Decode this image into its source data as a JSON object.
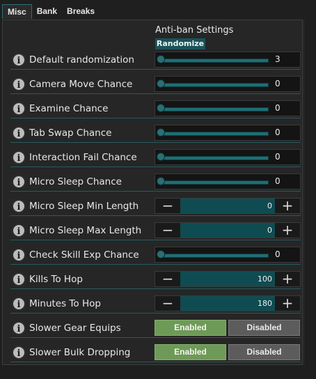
{
  "tabs": [
    {
      "label": "Misc",
      "active": true
    },
    {
      "label": "Bank"
    },
    {
      "label": "Breaks"
    }
  ],
  "section": {
    "title": "Anti-ban Settings",
    "randomize_label": "Randomize"
  },
  "rows": [
    {
      "label": "Default randomization",
      "control": "slider",
      "value": "3",
      "fraction": 0.0
    },
    {
      "label": "Camera Move Chance",
      "control": "slider",
      "value": "0",
      "fraction": 0.0
    },
    {
      "label": "Examine Chance",
      "control": "slider",
      "value": "0",
      "fraction": 0.0
    },
    {
      "label": "Tab Swap Chance",
      "control": "slider",
      "value": "0",
      "fraction": 0.0
    },
    {
      "label": "Interaction Fail Chance",
      "control": "slider",
      "value": "0",
      "fraction": 0.0
    },
    {
      "label": "Micro Sleep Chance",
      "control": "slider",
      "value": "0",
      "fraction": 0.0
    },
    {
      "label": "Micro Sleep Min Length",
      "control": "stepper",
      "value": "0",
      "minus": "−",
      "plus": "+"
    },
    {
      "label": "Micro Sleep Max Length",
      "control": "stepper",
      "value": "0",
      "minus": "−",
      "plus": "+"
    },
    {
      "label": "Check Skill Exp Chance",
      "control": "slider",
      "value": "0",
      "fraction": 0.0
    },
    {
      "label": "Kills To Hop",
      "control": "stepper",
      "value": "100",
      "minus": "−",
      "plus": "+"
    },
    {
      "label": "Minutes To Hop",
      "control": "stepper",
      "value": "180",
      "minus": "−",
      "plus": "+"
    },
    {
      "label": "Slower Gear Equips",
      "control": "toggle",
      "enabled_label": "Enabled",
      "disabled_label": "Disabled",
      "selected": "Enabled"
    },
    {
      "label": "Slower Bulk Dropping",
      "control": "toggle",
      "enabled_label": "Enabled",
      "disabled_label": "Disabled",
      "selected": "Enabled"
    }
  ],
  "icons": {
    "info": "i"
  },
  "colors": {
    "accent_teal": "#1a5359",
    "enabled_green": "#6e9a57",
    "disabled_gray": "#5c5c5c"
  }
}
